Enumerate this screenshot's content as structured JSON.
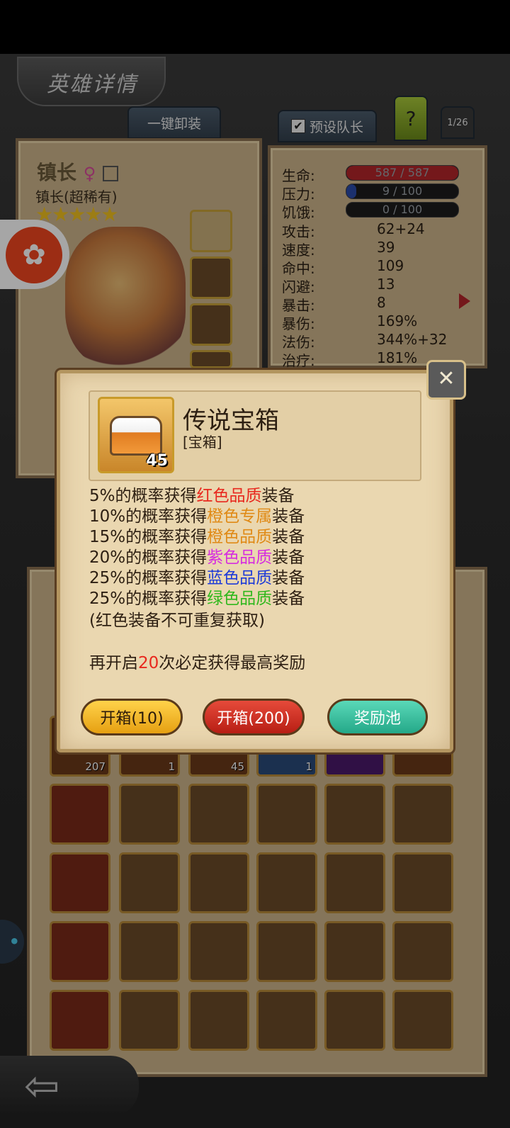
{
  "header": {
    "title": "英雄详情"
  },
  "tabs": {
    "unequip": "一键卸装",
    "preset": "预设队长",
    "help": "?",
    "page": "1/26"
  },
  "hero": {
    "name": "镇长",
    "gender": "♀",
    "class": "镇长(超稀有)",
    "stars": "★★★★★"
  },
  "stats": {
    "hp_label": "生命:",
    "hp": "587 / 587",
    "hp_fraction": 1.0,
    "stress_label": "压力:",
    "stress": "9 / 100",
    "stress_fraction": 0.09,
    "hunger_label": "饥饿:",
    "hunger": "0 / 100",
    "hunger_fraction": 0.0,
    "rows": [
      {
        "label": "攻击:",
        "value": "62+24"
      },
      {
        "label": "速度:",
        "value": "39"
      },
      {
        "label": "命中:",
        "value": "109"
      },
      {
        "label": "闪避:",
        "value": "13"
      },
      {
        "label": "暴击:",
        "value": "8"
      },
      {
        "label": "暴伤:",
        "value": "169%"
      },
      {
        "label": "法伤:",
        "value": "344%+32"
      },
      {
        "label": "治疗:",
        "value": "181%"
      }
    ]
  },
  "inventory": {
    "qty_row1": [
      "207",
      "1",
      "45",
      "1"
    ]
  },
  "dialog": {
    "item_name": "传说宝箱",
    "item_type": "[宝箱]",
    "item_qty": "45",
    "lines": [
      {
        "prefix": "5%的概率获得",
        "quality": "红色品质",
        "suffix": "装备"
      },
      {
        "prefix": "10%的概率获得",
        "quality": "橙色专属",
        "suffix": "装备"
      },
      {
        "prefix": "15%的概率获得",
        "quality": "橙色品质",
        "suffix": "装备"
      },
      {
        "prefix": "20%的概率获得",
        "quality": "紫色品质",
        "suffix": "装备"
      },
      {
        "prefix": "25%的概率获得",
        "quality": "蓝色品质",
        "suffix": "装备"
      },
      {
        "prefix": "25%的概率获得",
        "quality": "绿色品质",
        "suffix": "装备"
      }
    ],
    "note": "(红色装备不可重复获取)",
    "pity_prefix": "再开启",
    "pity_count": "20",
    "pity_suffix": "次必定获得最高奖励",
    "btn_open10": "开箱(10)",
    "btn_open200": "开箱(200)",
    "btn_pool": "奖励池",
    "colors": {
      "red": "#e8281e",
      "orange": "#e08a16",
      "purple": "#d62ce0",
      "blue": "#1e3ad8",
      "green": "#2fb81c"
    }
  },
  "icons": {
    "close": "crossed-swords-icon",
    "back": "back-arrow-icon",
    "app": "camera-app-icon"
  }
}
